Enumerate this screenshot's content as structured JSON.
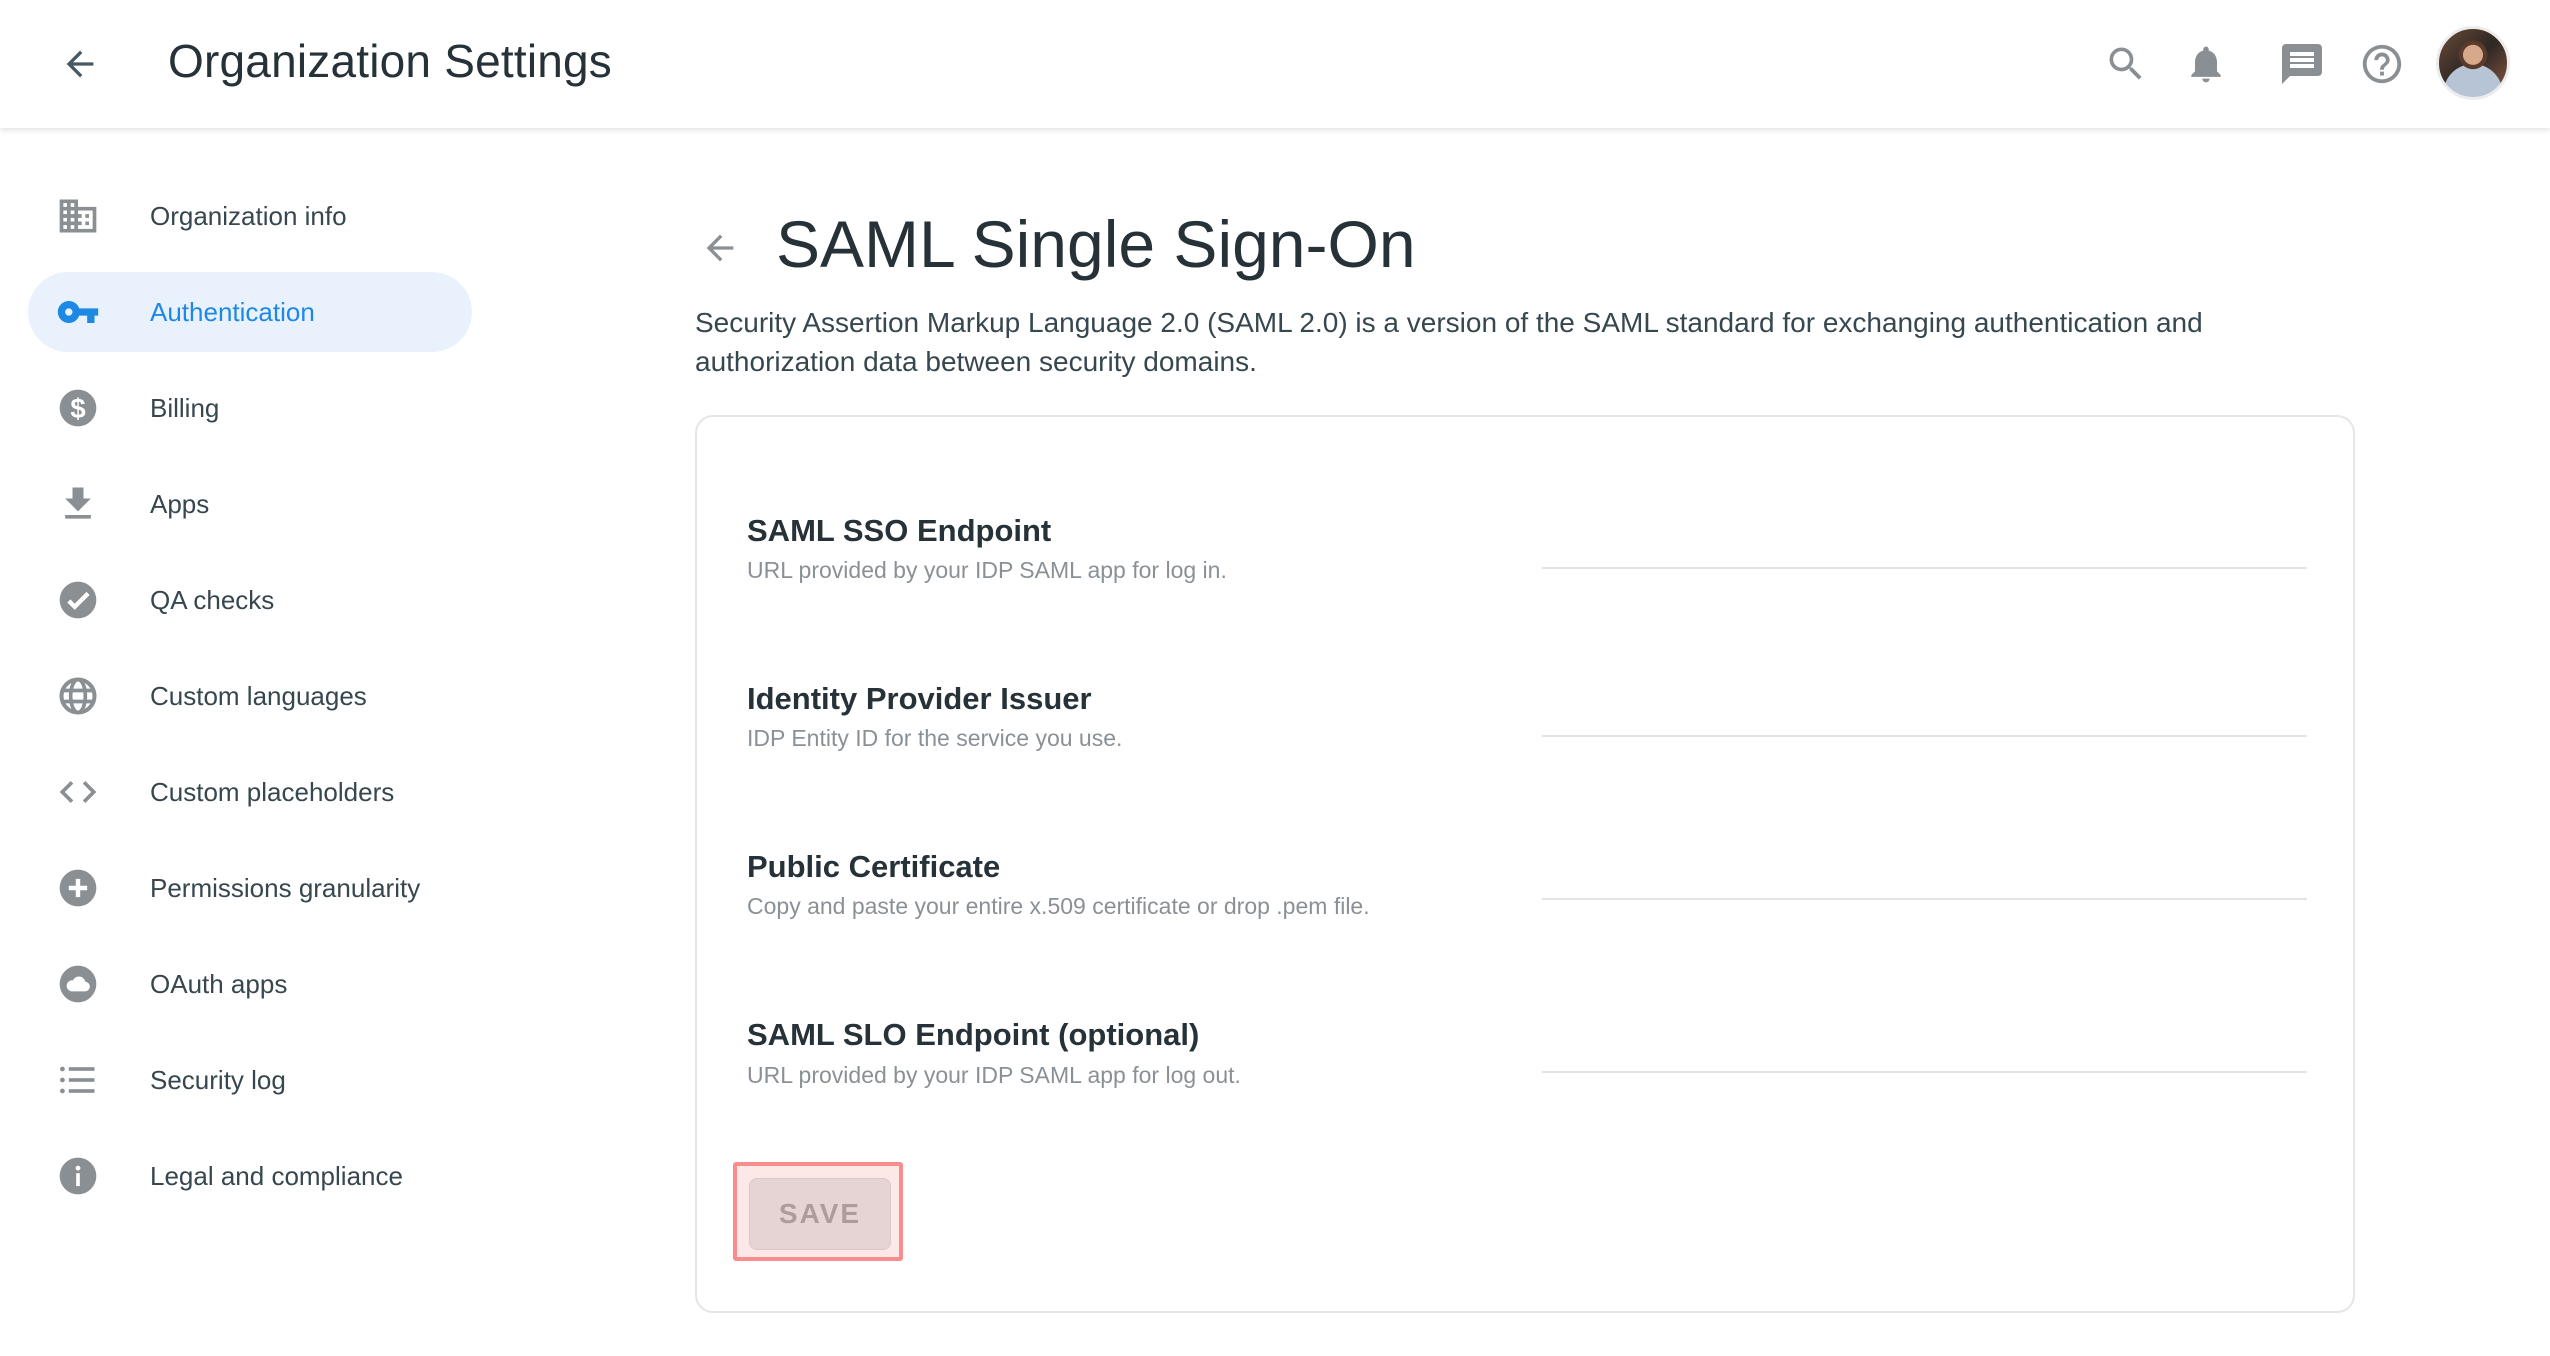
{
  "header": {
    "title": "Organization Settings",
    "back_icon": "arrow-back-icon",
    "actions": [
      {
        "name": "search",
        "icon": "search-icon"
      },
      {
        "name": "notifications",
        "icon": "bell-icon"
      },
      {
        "name": "messages",
        "icon": "chat-icon"
      },
      {
        "name": "help",
        "icon": "help-circle-icon"
      }
    ],
    "avatar": "user-avatar"
  },
  "sidebar": {
    "active_color": "#1e88e5",
    "active_bg": "#e8f1fc",
    "items": [
      {
        "label": "Organization info",
        "icon": "building-icon",
        "active": false
      },
      {
        "label": "Authentication",
        "icon": "key-icon",
        "active": true
      },
      {
        "label": "Billing",
        "icon": "dollar-icon",
        "active": false
      },
      {
        "label": "Apps",
        "icon": "download-icon",
        "active": false
      },
      {
        "label": "QA checks",
        "icon": "check-circle-icon",
        "active": false
      },
      {
        "label": "Custom languages",
        "icon": "globe-icon",
        "active": false
      },
      {
        "label": "Custom placeholders",
        "icon": "code-icon",
        "active": false
      },
      {
        "label": "Permissions granularity",
        "icon": "plus-circle-icon",
        "active": false
      },
      {
        "label": "OAuth apps",
        "icon": "cloud-icon",
        "active": false
      },
      {
        "label": "Security log",
        "icon": "list-icon",
        "active": false
      },
      {
        "label": "Legal and compliance",
        "icon": "info-icon",
        "active": false
      }
    ]
  },
  "main": {
    "title": "SAML Single Sign-On",
    "description": "Security Assertion Markup Language 2.0 (SAML 2.0) is a version of the SAML standard for exchanging authentication and authorization data between security domains.",
    "fields": [
      {
        "label": "SAML SSO Endpoint",
        "help": "URL provided by your IDP SAML app for log in.",
        "value": "",
        "placeholder": ""
      },
      {
        "label": "Identity Provider Issuer",
        "help": "IDP Entity ID for the service you use.",
        "value": "",
        "placeholder": ""
      },
      {
        "label": "Public Certificate",
        "help": "Copy and paste your entire x.509 certificate or drop .pem file.",
        "value": "",
        "placeholder": ""
      },
      {
        "label": "SAML SLO Endpoint (optional)",
        "help": "URL provided by your IDP SAML app for log out.",
        "value": "",
        "placeholder": ""
      }
    ],
    "save_label": "SAVE",
    "save_disabled": true
  }
}
